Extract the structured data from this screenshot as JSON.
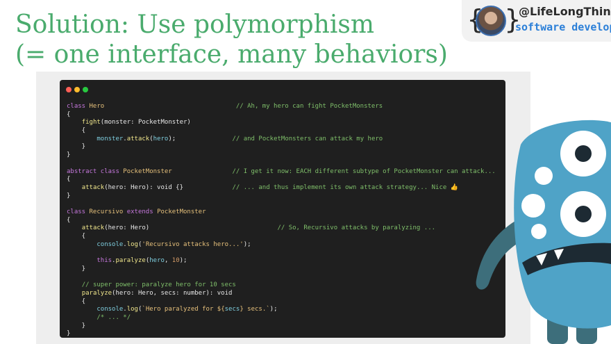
{
  "slide": {
    "title_line1": "Solution: Use polymorphism",
    "title_line2": "(= one interface, many behaviors)"
  },
  "badge": {
    "brace_open": "{",
    "brace_close": "}",
    "handle": "@LifeLongThinker",
    "role": "software developer"
  },
  "editor": {
    "lines": [
      [
        [
          "kw",
          "class "
        ],
        [
          "cls",
          "Hero"
        ],
        [
          "t",
          "                                   "
        ],
        [
          "cm",
          "// Ah, my hero can fight PocketMonsters"
        ]
      ],
      [
        [
          "t",
          "{"
        ]
      ],
      [
        [
          "t",
          "    "
        ],
        [
          "fn",
          "fight"
        ],
        [
          "t",
          "(monster: PocketMonster)"
        ]
      ],
      [
        [
          "t",
          "    {"
        ]
      ],
      [
        [
          "t",
          "        "
        ],
        [
          "prop",
          "monster"
        ],
        [
          "t",
          "."
        ],
        [
          "fn",
          "attack"
        ],
        [
          "t",
          "("
        ],
        [
          "prop",
          "hero"
        ],
        [
          "t",
          ");               "
        ],
        [
          "cm",
          "// and PocketMonsters can attack my hero"
        ]
      ],
      [
        [
          "t",
          "    }"
        ]
      ],
      [
        [
          "t",
          "}"
        ]
      ],
      [
        [
          "t",
          ""
        ]
      ],
      [
        [
          "kw",
          "abstract class "
        ],
        [
          "cls",
          "PocketMonster"
        ],
        [
          "t",
          "                "
        ],
        [
          "cm",
          "// I get it now: EACH different subtype of PocketMonster can attack..."
        ]
      ],
      [
        [
          "t",
          "{"
        ]
      ],
      [
        [
          "t",
          "    "
        ],
        [
          "fn",
          "attack"
        ],
        [
          "t",
          "(hero: Hero): void {}             "
        ],
        [
          "cm",
          "// ... and thus implement its own attack strategy... Nice 👍"
        ]
      ],
      [
        [
          "t",
          "}"
        ]
      ],
      [
        [
          "t",
          ""
        ]
      ],
      [
        [
          "kw",
          "class "
        ],
        [
          "cls",
          "Recursivo "
        ],
        [
          "kw",
          "extends "
        ],
        [
          "cls",
          "PocketMonster"
        ]
      ],
      [
        [
          "t",
          "{"
        ]
      ],
      [
        [
          "t",
          "    "
        ],
        [
          "fn",
          "attack"
        ],
        [
          "t",
          "(hero: Hero)                                  "
        ],
        [
          "cm",
          "// So, Recursivo attacks by paralyzing ..."
        ]
      ],
      [
        [
          "t",
          "    {"
        ]
      ],
      [
        [
          "t",
          "        "
        ],
        [
          "prop",
          "console"
        ],
        [
          "t",
          "."
        ],
        [
          "fn",
          "log"
        ],
        [
          "t",
          "("
        ],
        [
          "str",
          "'Recursivo attacks hero...'"
        ],
        [
          "t",
          ");"
        ]
      ],
      [
        [
          "t",
          ""
        ]
      ],
      [
        [
          "t",
          "        "
        ],
        [
          "kw",
          "this"
        ],
        [
          "t",
          "."
        ],
        [
          "fn",
          "paralyze"
        ],
        [
          "t",
          "("
        ],
        [
          "prop",
          "hero"
        ],
        [
          "t",
          ", "
        ],
        [
          "num",
          "10"
        ],
        [
          "t",
          ");"
        ]
      ],
      [
        [
          "t",
          "    }"
        ]
      ],
      [
        [
          "t",
          ""
        ]
      ],
      [
        [
          "t",
          "    "
        ],
        [
          "cm",
          "// super power: paralyze hero for 10 secs"
        ]
      ],
      [
        [
          "t",
          "    "
        ],
        [
          "fn",
          "paralyze"
        ],
        [
          "t",
          "(hero: Hero, secs: number): void"
        ]
      ],
      [
        [
          "t",
          "    {"
        ]
      ],
      [
        [
          "t",
          "        "
        ],
        [
          "prop",
          "console"
        ],
        [
          "t",
          "."
        ],
        [
          "fn",
          "log"
        ],
        [
          "t",
          "("
        ],
        [
          "str",
          "`Hero paralyzed for ${"
        ],
        [
          "prop",
          "secs"
        ],
        [
          "str",
          "} secs.`"
        ],
        [
          "t",
          ");"
        ]
      ],
      [
        [
          "t",
          "        "
        ],
        [
          "cm",
          "/* ... */"
        ]
      ],
      [
        [
          "t",
          "    }"
        ]
      ],
      [
        [
          "t",
          "}"
        ]
      ]
    ]
  },
  "colors": {
    "title": "#4aab6d",
    "handle": "#2b2b2b",
    "role": "#2b7fd8",
    "editor_bg": "#1f1f1f",
    "monster_body": "#4fa3c7",
    "monster_limb": "#3d6e7b"
  }
}
